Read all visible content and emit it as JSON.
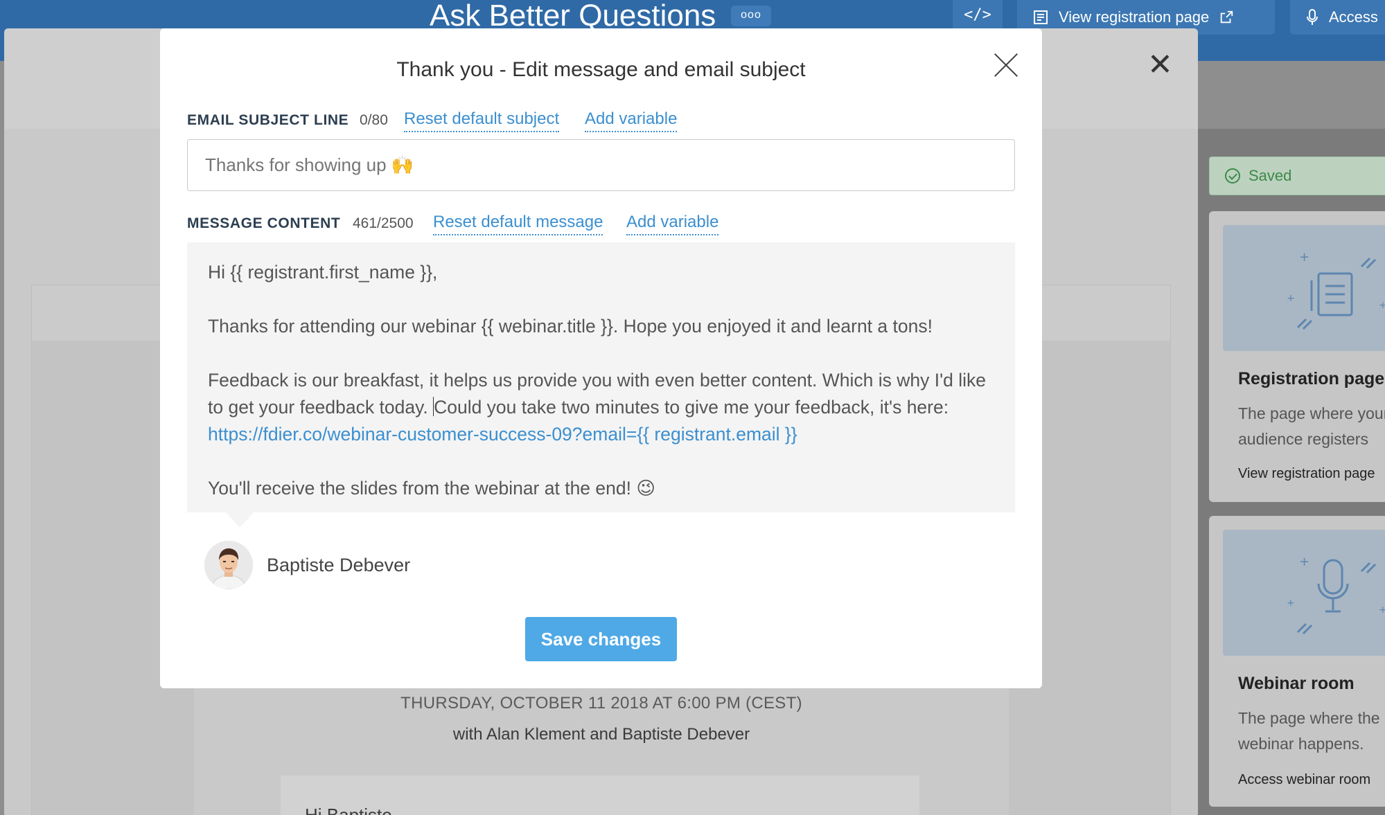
{
  "app": {
    "title": "Ask Better Questions",
    "more_label": "ooo",
    "code_label": "</>",
    "view_registration_label": "View registration page",
    "access_label": "Access"
  },
  "background": {
    "event_date": "THURSDAY, OCTOBER 11 2018 AT 6:00 PM (CEST)",
    "hosts": "with Alan Klement and Baptiste Debever",
    "greeting": "Hi Baptiste"
  },
  "sidebar": {
    "status": "Saved",
    "cards": [
      {
        "title": "Registration page",
        "description": "The page where your audience registers",
        "link": "View registration page"
      },
      {
        "title": "Webinar room",
        "description": "The page where the webinar happens.",
        "link": "Access webinar room"
      }
    ]
  },
  "modal": {
    "title": "Thank you - Edit message and email subject",
    "subject": {
      "label": "EMAIL SUBJECT LINE",
      "counter": "0/80",
      "reset_link": "Reset default subject",
      "add_variable_link": "Add variable",
      "placeholder": "Thanks for showing up 🙌"
    },
    "message": {
      "label": "MESSAGE CONTENT",
      "counter": "461/2500",
      "reset_link": "Reset default message",
      "add_variable_link": "Add variable",
      "line1": "Hi {{ registrant.first_name }},",
      "line2": "Thanks for attending our webinar {{ webinar.title }}. Hope you enjoyed it and learnt a tons!",
      "line3a": "Feedback is our breakfast, it helps us provide you with even better content. Which is why I'd like to get your feedback today. ",
      "line3b": "Could you take two minutes to give me your feedback, it's here: ",
      "line3_link": "https://fdier.co/webinar-customer-success-09?email={{ registrant.email }}",
      "line4": "You'll receive the slides from the webinar at the end! 😉"
    },
    "author": "Baptiste Debever",
    "save_label": "Save changes"
  },
  "colors": {
    "accent": "#4ea9e6",
    "link": "#3b8fd0",
    "topbar": "#2f6aa6",
    "saved": "#3c8a49"
  }
}
